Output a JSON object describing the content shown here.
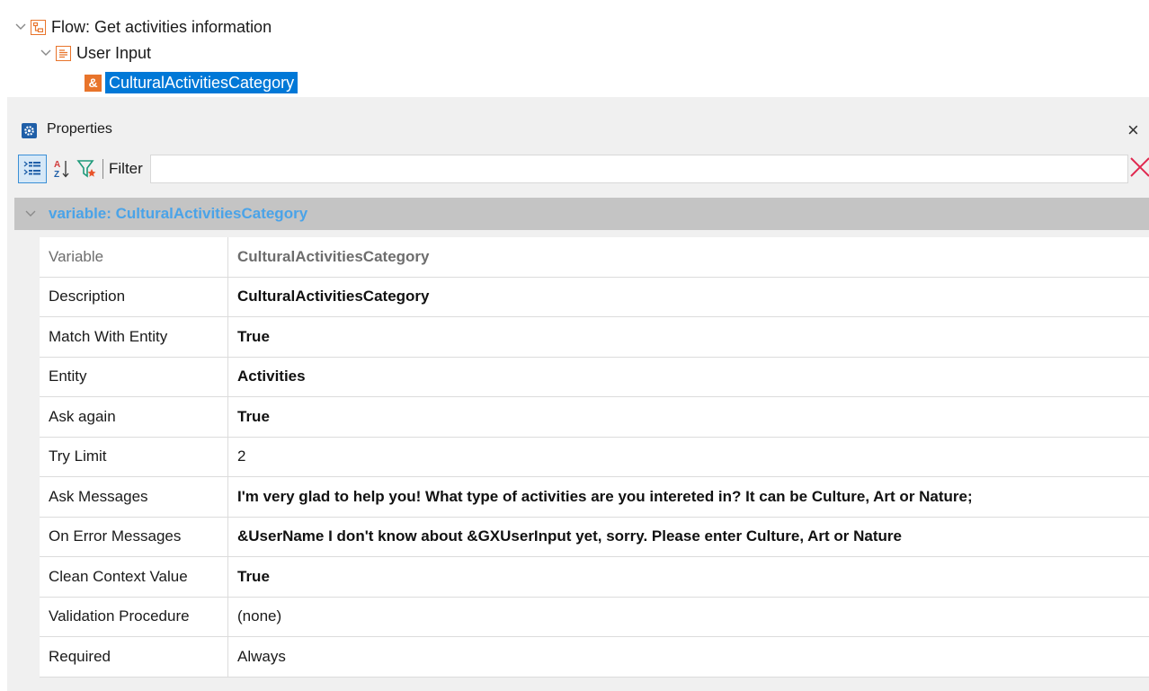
{
  "tree": {
    "flow_label": "Flow: Get activities information",
    "user_input_label": "User Input",
    "variable_label": "CulturalActivitiesCategory",
    "variable_icon_glyph": "&"
  },
  "panel": {
    "title": "Properties",
    "close_glyph": "×",
    "filter_label": "Filter",
    "filter_value": "",
    "section_title": "variable: CulturalActivitiesCategory"
  },
  "properties": [
    {
      "name": "Variable",
      "value": "CulturalActivitiesCategory"
    },
    {
      "name": "Description",
      "value": "CulturalActivitiesCategory"
    },
    {
      "name": "Match With Entity",
      "value": "True"
    },
    {
      "name": "Entity",
      "value": "Activities"
    },
    {
      "name": "Ask again",
      "value": "True"
    },
    {
      "name": "Try Limit",
      "value": "2"
    },
    {
      "name": "Ask Messages",
      "value": "I'm very glad to help you! What type of activities are you intereted in? It can be Culture, Art or Nature;"
    },
    {
      "name": "On Error Messages",
      "value": "&UserName I don't know about &GXUserInput yet, sorry. Please enter Culture, Art or Nature"
    },
    {
      "name": "Clean Context Value",
      "value": "True"
    },
    {
      "name": "Validation Procedure",
      "value": "(none)"
    },
    {
      "name": "Required",
      "value": "Always"
    }
  ],
  "colors": {
    "selection": "#0078d7",
    "tree_icon": "#e8742b",
    "section_title": "#4aa3e8",
    "section_bg": "#c4c4c4",
    "clear_filter": "#e0284f"
  },
  "icons": {
    "flow": "flow-icon",
    "user_input": "user-input-icon",
    "variable": "variable-icon",
    "properties": "gear-icon",
    "categorized": "categorized-view-icon",
    "alphabetical": "sort-alphabetical-icon",
    "filter_modified": "filter-modified-icon",
    "clear": "clear-filter-icon"
  }
}
